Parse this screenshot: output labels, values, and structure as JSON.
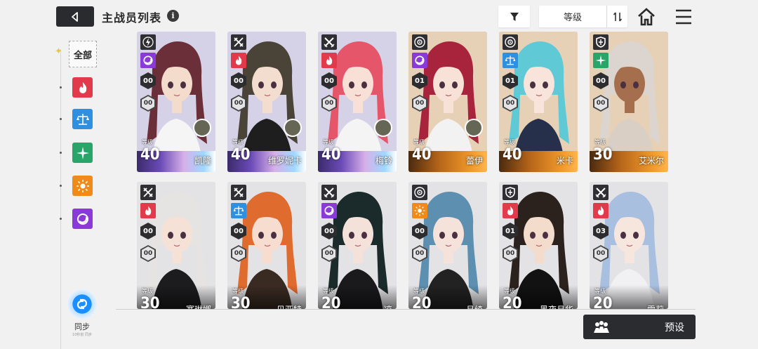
{
  "header": {
    "title": "主战员列表",
    "info_glyph": "i",
    "sort_label": "等级",
    "icons": [
      "back-arrow-icon",
      "info-icon",
      "filter-funnel-icon",
      "sort-order-icon",
      "home-icon",
      "menu-icon"
    ]
  },
  "sidebar": {
    "all_label": "全部",
    "elements": [
      {
        "name": "fire",
        "color": "#e23a4a"
      },
      {
        "name": "balance",
        "color": "#2f8fe0"
      },
      {
        "name": "wind",
        "color": "#2aa56a"
      },
      {
        "name": "sun",
        "color": "#f08a18"
      },
      {
        "name": "void",
        "color": "#8a3ad6"
      }
    ],
    "sync_label": "同步",
    "sync_sub": "10秒前 同步"
  },
  "cards": [
    {
      "name": "凯隆",
      "level": "40",
      "level_label": "等级",
      "role": "lightning",
      "element": "void",
      "element_color": "#8a3ad6",
      "stat1": "00",
      "stat2": "00",
      "bar": "rainbow",
      "hair": "#6b2f3a",
      "skin": "#f4dccd",
      "outfit": "#f5f5f5",
      "has_avatar": true
    },
    {
      "name": "维罗妮卡",
      "level": "40",
      "level_label": "等级",
      "role": "blades",
      "element": "fire",
      "element_color": "#e23a4a",
      "stat1": "00",
      "stat2": "00",
      "bar": "rainbow",
      "hair": "#4a4338",
      "skin": "#f3ddcf",
      "outfit": "#1e1e1e",
      "has_avatar": true
    },
    {
      "name": "梅铃",
      "level": "40",
      "level_label": "等级",
      "role": "swords",
      "element": "fire",
      "element_color": "#e23a4a",
      "stat1": "00",
      "stat2": "00",
      "bar": "rainbow",
      "hair": "#e5566a",
      "skin": "#f8e0d6",
      "outfit": "#f4f4f4",
      "has_avatar": true
    },
    {
      "name": "蕾伊",
      "level": "40",
      "level_label": "等级",
      "role": "target",
      "element": "void",
      "element_color": "#8a3ad6",
      "stat1": "01",
      "stat2": "00",
      "bar": "orange",
      "hair": "#a8243d",
      "skin": "#f8e2d8",
      "outfit": "#f2f2f2",
      "has_avatar": true
    },
    {
      "name": "米卡",
      "level": "40",
      "level_label": "等级",
      "role": "target",
      "element": "balance",
      "element_color": "#2f8fe0",
      "stat1": "01",
      "stat2": "00",
      "bar": "orange",
      "hair": "#5fc9d6",
      "skin": "#f8e4da",
      "outfit": "#27304a",
      "has_avatar": false
    },
    {
      "name": "艾米尔",
      "level": "30",
      "level_label": "等级",
      "role": "shield",
      "element": "wind",
      "element_color": "#2aa56a",
      "stat1": "00",
      "stat2": "00",
      "bar": "orange",
      "hair": "#dcd5cf",
      "skin": "#a56e4d",
      "outfit": "#d9cfc4",
      "has_avatar": false
    },
    {
      "name": "赛琳娜",
      "level": "30",
      "level_label": "等级",
      "role": "blades",
      "element": "fire",
      "element_color": "#e23a4a",
      "stat1": "00",
      "stat2": "00",
      "bar": "dark",
      "hair": "#e6e4e2",
      "skin": "#f6e1d7",
      "outfit": "#1c1c1e",
      "has_avatar": false
    },
    {
      "name": "贝亚特",
      "level": "30",
      "level_label": "等级",
      "role": "blades",
      "element": "balance",
      "element_color": "#2f8fe0",
      "stat1": "00",
      "stat2": "00",
      "bar": "dark",
      "hair": "#e06b2e",
      "skin": "#f6ddcf",
      "outfit": "#3a2b22",
      "has_avatar": false
    },
    {
      "name": "凉",
      "level": "20",
      "level_label": "等级",
      "role": "swords",
      "element": "void",
      "element_color": "#8a3ad6",
      "stat1": "00",
      "stat2": "00",
      "bar": "dark",
      "hair": "#1b2a2a",
      "skin": "#f4e2da",
      "outfit": "#1a1a1d",
      "has_avatar": false
    },
    {
      "name": "月绮",
      "level": "20",
      "level_label": "等级",
      "role": "target",
      "element": "sun",
      "element_color": "#f08a18",
      "stat1": "00",
      "stat2": "00",
      "bar": "dark",
      "hair": "#5d8fb0",
      "skin": "#f5e2da",
      "outfit": "#222",
      "has_avatar": false
    },
    {
      "name": "黑夜月华",
      "level": "20",
      "level_label": "等级",
      "role": "shield",
      "element": "fire",
      "element_color": "#e23a4a",
      "stat1": "01",
      "stat2": "00",
      "bar": "dark",
      "hair": "#2b211d",
      "skin": "#f4dccc",
      "outfit": "#121212",
      "has_avatar": false
    },
    {
      "name": "雪莉",
      "level": "20",
      "level_label": "等级",
      "role": "swords",
      "element": "fire",
      "element_color": "#e23a4a",
      "stat1": "03",
      "stat2": "00",
      "bar": "dark",
      "hair": "#a9bfe0",
      "skin": "#f7e6de",
      "outfit": "#f1f1f4",
      "has_avatar": false
    }
  ],
  "footer": {
    "preset_label": "预设"
  }
}
